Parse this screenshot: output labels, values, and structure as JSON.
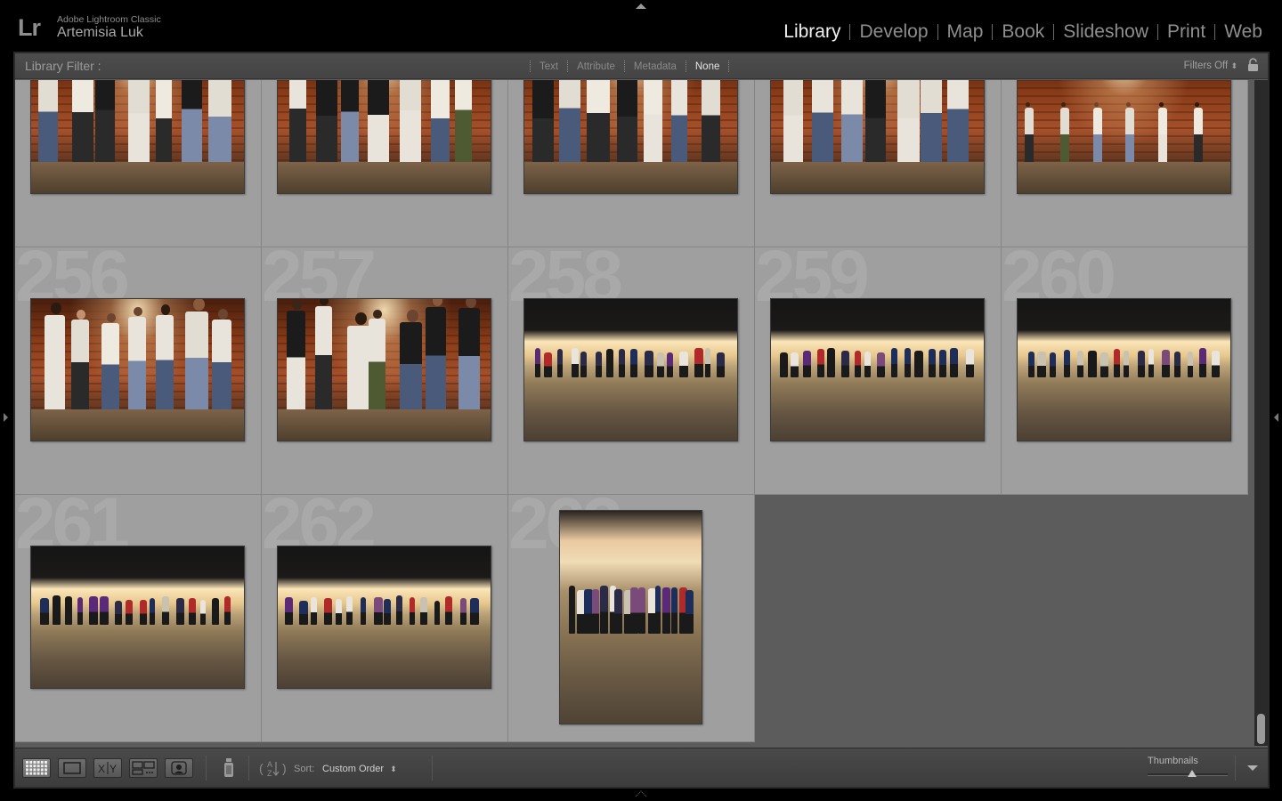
{
  "app": {
    "logo": "Lr",
    "product_name": "Adobe Lightroom Classic",
    "user_name": "Artemisia Luk"
  },
  "modules": [
    {
      "label": "Library",
      "active": true
    },
    {
      "label": "Develop",
      "active": false
    },
    {
      "label": "Map",
      "active": false
    },
    {
      "label": "Book",
      "active": false
    },
    {
      "label": "Slideshow",
      "active": false
    },
    {
      "label": "Print",
      "active": false
    },
    {
      "label": "Web",
      "active": false
    }
  ],
  "filter_bar": {
    "title": "Library Filter :",
    "options": [
      {
        "label": "Text",
        "active": false
      },
      {
        "label": "Attribute",
        "active": false
      },
      {
        "label": "Metadata",
        "active": false
      },
      {
        "label": "None",
        "active": true
      }
    ],
    "filters_status": "Filters Off"
  },
  "grid": {
    "rows": [
      {
        "cells": [
          {
            "number": "",
            "scene": "brick",
            "orientation": "landscape"
          },
          {
            "number": "",
            "scene": "brick",
            "orientation": "landscape"
          },
          {
            "number": "",
            "scene": "brick",
            "orientation": "landscape"
          },
          {
            "number": "",
            "scene": "brick",
            "orientation": "landscape"
          },
          {
            "number": "",
            "scene": "brick-wide",
            "orientation": "landscape"
          }
        ]
      },
      {
        "cells": [
          {
            "number": "256",
            "scene": "brick",
            "orientation": "landscape"
          },
          {
            "number": "257",
            "scene": "brick",
            "orientation": "landscape"
          },
          {
            "number": "258",
            "scene": "dark",
            "orientation": "landscape"
          },
          {
            "number": "259",
            "scene": "dark",
            "orientation": "landscape"
          },
          {
            "number": "260",
            "scene": "dark",
            "orientation": "landscape"
          }
        ]
      },
      {
        "cells": [
          {
            "number": "261",
            "scene": "dark",
            "orientation": "landscape"
          },
          {
            "number": "262",
            "scene": "dark",
            "orientation": "landscape"
          },
          {
            "number": "263",
            "scene": "dark-v",
            "orientation": "portrait"
          }
        ]
      }
    ]
  },
  "toolbar": {
    "sort_label": "Sort:",
    "sort_value": "Custom Order",
    "thumbnails_label": "Thumbnails",
    "thumbnail_size": 0.55,
    "view_modes": [
      {
        "name": "grid-view",
        "active": true
      },
      {
        "name": "loupe-view",
        "active": false
      },
      {
        "name": "compare-view",
        "active": false
      },
      {
        "name": "survey-view",
        "active": false
      },
      {
        "name": "people-view",
        "active": false
      }
    ]
  },
  "colors": {
    "active_module": "#f0f0f0",
    "inactive_module": "#8e8e8e",
    "cell_bg": "#9f9f9f",
    "empty_grid_bg": "#5c5c5c"
  }
}
